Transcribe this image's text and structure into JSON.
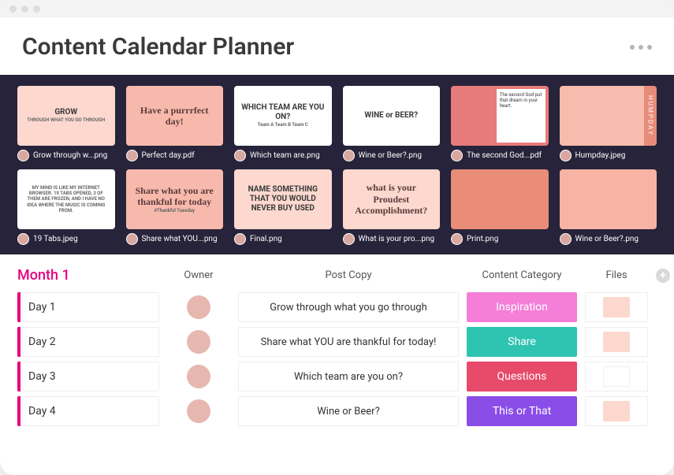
{
  "header": {
    "title": "Content Calendar Planner"
  },
  "gallery": [
    [
      {
        "name": "Grow through w...png",
        "art": {
          "variant": "t-pinklight",
          "big": "GROW",
          "sub": "THROUGH WHAT YOU GO THROUGH"
        }
      },
      {
        "name": "Perfect day.pdf",
        "art": {
          "variant": "t-script",
          "script": "Have a purrrfect day!"
        }
      },
      {
        "name": "Which team are.png",
        "art": {
          "variant": "t-white",
          "big": "WHICH TEAM ARE YOU ON?",
          "tiny": "Team A   Team B   Team C"
        }
      },
      {
        "name": "Wine or Beer?.png",
        "art": {
          "variant": "t-white",
          "big": "WINE or BEER?"
        }
      },
      {
        "name": "The second God...pdf",
        "art": {
          "variant": "t-peony",
          "quote": "The second God put that dream in your heart."
        }
      },
      {
        "name": "Humpday.jpeg",
        "art": {
          "variant": "t-hump",
          "side": "HUMPDAY"
        }
      }
    ],
    [
      {
        "name": "19 Tabs.jpeg",
        "art": {
          "variant": "t-white",
          "tiny": "MY MIND IS LIKE MY INTERNET BROWSER. 19 TABS OPENED, 3 OF THEM ARE FROZEN, AND I HAVE NO IDEA WHERE THE MUSIC IS COMING FROM."
        }
      },
      {
        "name": "Share what YOU...png",
        "art": {
          "variant": "t-script",
          "script": "Share what you are thankful for today",
          "sub": "#Thankful Tuesday"
        }
      },
      {
        "name": "Final.png",
        "art": {
          "variant": "t-pinklight",
          "big": "NAME SOMETHING THAT YOU WOULD NEVER BUY USED"
        }
      },
      {
        "name": "What is your pro...png",
        "art": {
          "variant": "t-pinklight",
          "script": "what is your Proudest Accomplishment?"
        }
      },
      {
        "name": "Print.png",
        "art": {
          "variant": "t-print"
        }
      },
      {
        "name": "Wine or Beer?.png",
        "art": {
          "variant": "t-winepink"
        }
      }
    ]
  ],
  "table": {
    "month": "Month 1",
    "columns": {
      "owner": "Owner",
      "copy": "Post Copy",
      "category": "Content Category",
      "files": "Files"
    },
    "rows": [
      {
        "day": "Day 1",
        "copy": "Grow through what you go through",
        "category": "Inspiration",
        "cat_class": "c-insp"
      },
      {
        "day": "Day 2",
        "copy": "Share what YOU are thankful for today!",
        "category": "Share",
        "cat_class": "c-share"
      },
      {
        "day": "Day 3",
        "copy": "Which team are you on?",
        "category": "Questions",
        "cat_class": "c-quest"
      },
      {
        "day": "Day 4",
        "copy": "Wine or Beer?",
        "category": "This or That",
        "cat_class": "c-this"
      }
    ]
  }
}
